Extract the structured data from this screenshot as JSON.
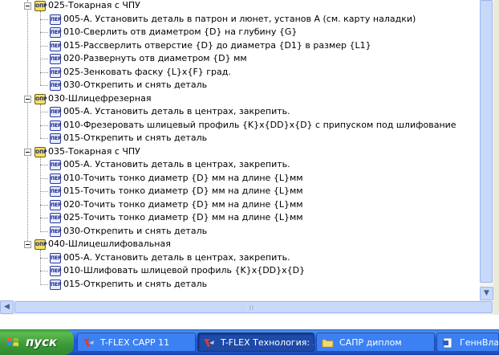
{
  "tree": {
    "operations": [
      {
        "label": "025-Токарная с ЧПУ",
        "icon_text": "ОПР",
        "transitions": [
          {
            "label": "005-А. Установить деталь в патрон и люнет, установ А (см. карту наладки)",
            "icon_text": "ПЕР"
          },
          {
            "label": "010-Сверлить отв диаметром {D} на глубину {G}",
            "icon_text": "ПЕР"
          },
          {
            "label": "015-Рассверлить отверстие {D} до диаметра {D1} в размер {L1}",
            "icon_text": "ПЕР"
          },
          {
            "label": "020-Развернуть отв диаметром {D} мм",
            "icon_text": "ПЕР"
          },
          {
            "label": "025-Зенковать фаску {L}x{F} град.",
            "icon_text": "ПЕР"
          },
          {
            "label": "030-Открепить и снять деталь",
            "icon_text": "ПЕР"
          }
        ]
      },
      {
        "label": "030-Шлицефрезерная",
        "icon_text": "ОПР",
        "transitions": [
          {
            "label": "005-А. Установить деталь в центрах, закрепить.",
            "icon_text": "ПЕР"
          },
          {
            "label": "010-Фрезеровать шлицевый профиль {K}x{DD}x{D} с припуском под шлифование",
            "icon_text": "ПЕР"
          },
          {
            "label": "015-Открепить и снять деталь",
            "icon_text": "ПЕР"
          }
        ]
      },
      {
        "label": "035-Токарная с ЧПУ",
        "icon_text": "ОПР",
        "transitions": [
          {
            "label": "005-А. Установить деталь в центрах, закрепить.",
            "icon_text": "ПЕР"
          },
          {
            "label": "010-Точить тонко диаметр  {D} мм на длине {L}мм",
            "icon_text": "ПЕР"
          },
          {
            "label": "015-Точить тонко диаметр {D} мм на длине {L}мм",
            "icon_text": "ПЕР"
          },
          {
            "label": "020-Точить тонко диаметр {D} мм на длине {L}мм",
            "icon_text": "ПЕР"
          },
          {
            "label": "025-Точить тонко диаметр {D} мм на длине {L}мм",
            "icon_text": "ПЕР"
          },
          {
            "label": "030-Открепить и снять деталь",
            "icon_text": "ПЕР"
          }
        ]
      },
      {
        "label": "040-Шлицешлифовальная",
        "icon_text": "ОПР",
        "transitions": [
          {
            "label": "005-А. Установить деталь в центрах, закрепить.",
            "icon_text": "ПЕР"
          },
          {
            "label": "010-Шлифовать шлицевой профиль {K}x{DD}x{D}",
            "icon_text": "ПЕР"
          },
          {
            "label": "015-Открепить и снять деталь",
            "icon_text": "ПЕР"
          }
        ]
      }
    ]
  },
  "taskbar": {
    "start_label": "пуск",
    "tasks": [
      {
        "label": "T-FLEX CAPP 11",
        "icon": "tflex-icon",
        "active": false
      },
      {
        "label": "T-FLEX Технология: ...",
        "icon": "tflex-icon",
        "active": true
      },
      {
        "label": "САПР диплом",
        "icon": "folder-icon",
        "active": false
      },
      {
        "label": "ГеннВлад.d",
        "icon": "document-icon",
        "active": false
      }
    ]
  },
  "colors": {
    "taskbar": "#2157d7",
    "start": "#3a9a39",
    "scrollbar": "#c8d8fb",
    "op_icon": "#f2e25b"
  }
}
